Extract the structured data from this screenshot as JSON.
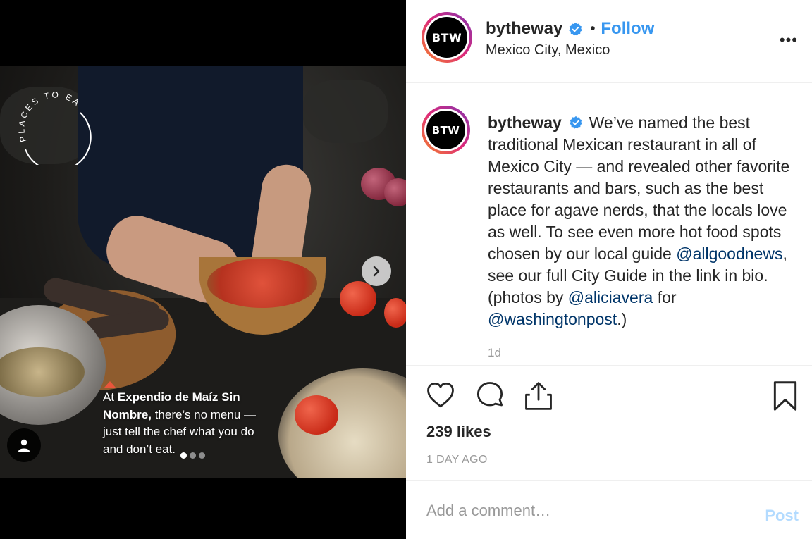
{
  "post": {
    "username": "bytheway",
    "avatar_text": "BTW",
    "follow_label": "Follow",
    "separator": "•",
    "location": "Mexico City, Mexico",
    "more_label": "•••"
  },
  "media": {
    "badge_text": "PLACES TO EAT",
    "caption_pre": "At ",
    "caption_bold": "Expendio de Maíz Sin Nombre,",
    "caption_post": " there’s no menu — just tell the chef what you do and don’t eat.",
    "carousel": {
      "count": 3,
      "active": 1
    }
  },
  "comment": {
    "username": "bytheway",
    "text_1": "We’ve named the best traditional Mexican restaurant in all of Mexico City — and revealed other favorite restaurants and bars, such as the best place for agave nerds, that the locals love as well. To see even more hot food spots chosen by our local guide ",
    "mention_1": "@allgoodnews",
    "text_2": ", see our full City Guide in the link in bio. (photos by ",
    "mention_2": "@aliciavera",
    "text_3": " for ",
    "mention_3": "@washingtonpost",
    "text_4": ".)",
    "time": "1d"
  },
  "actions": {
    "likes": "239 likes",
    "posted": "1 DAY AGO"
  },
  "composer": {
    "placeholder": "Add a comment…",
    "post_label": "Post"
  },
  "colors": {
    "link": "#003569",
    "follow": "#3897f0",
    "verified": "#3897f0",
    "post_disabled": "#b3dbff"
  },
  "icons": [
    "verified-badge-icon",
    "more-options-icon",
    "chevron-right-icon",
    "user-tag-icon",
    "heart-icon",
    "comment-icon",
    "share-icon",
    "bookmark-icon"
  ]
}
